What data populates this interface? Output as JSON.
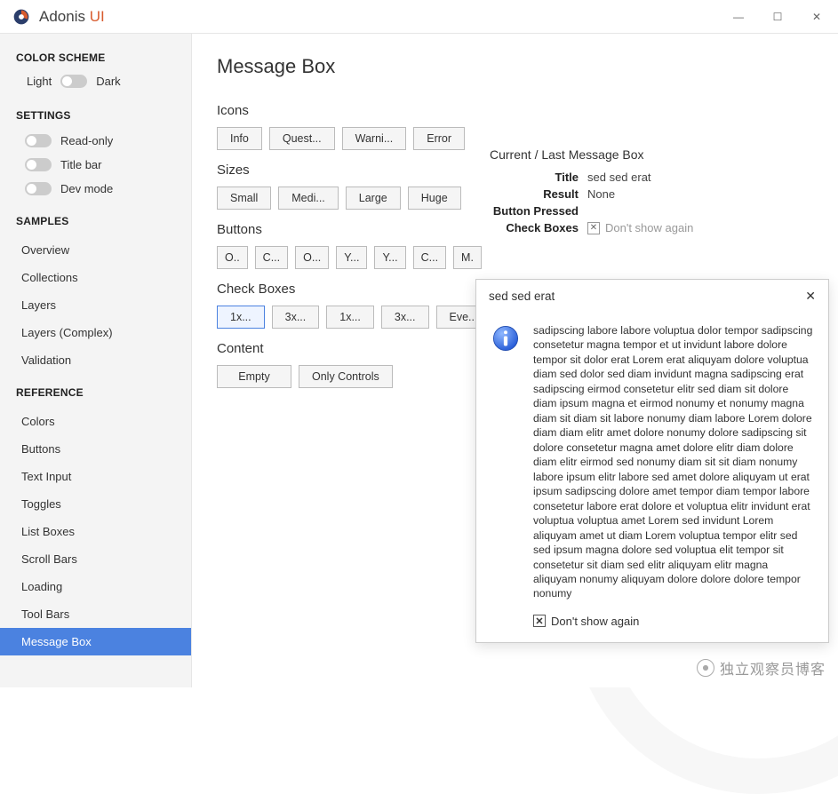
{
  "app": {
    "title_prefix": "Adonis",
    "title_suffix": " UI"
  },
  "window": {
    "minimize": "—",
    "maximize": "☐",
    "close": "✕"
  },
  "sidebar": {
    "color_scheme_heading": "COLOR SCHEME",
    "light": "Light",
    "dark": "Dark",
    "settings_heading": "SETTINGS",
    "settings": [
      {
        "label": "Read-only"
      },
      {
        "label": "Title bar"
      },
      {
        "label": "Dev mode"
      }
    ],
    "samples_heading": "SAMPLES",
    "samples": [
      {
        "label": "Overview"
      },
      {
        "label": "Collections"
      },
      {
        "label": "Layers"
      },
      {
        "label": "Layers (Complex)"
      },
      {
        "label": "Validation"
      }
    ],
    "reference_heading": "REFERENCE",
    "reference": [
      {
        "label": "Colors"
      },
      {
        "label": "Buttons"
      },
      {
        "label": "Text Input"
      },
      {
        "label": "Toggles"
      },
      {
        "label": "List Boxes"
      },
      {
        "label": "Scroll Bars"
      },
      {
        "label": "Loading"
      },
      {
        "label": "Tool Bars"
      },
      {
        "label": "Message Box",
        "active": true
      }
    ]
  },
  "page": {
    "title": "Message Box",
    "icons_label": "Icons",
    "icons": [
      "Info",
      "Quest...",
      "Warni...",
      "Error"
    ],
    "sizes_label": "Sizes",
    "sizes": [
      "Small",
      "Medi...",
      "Large",
      "Huge"
    ],
    "buttons_label": "Buttons",
    "buttons": [
      "O..",
      "C...",
      "O...",
      "Y...",
      "Y...",
      "C...",
      "M."
    ],
    "checkboxes_label": "Check Boxes",
    "checkboxes": [
      "1x...",
      "3x...",
      "1x...",
      "3x...",
      "Eve..."
    ],
    "checkbox_selected_index": 0,
    "content_label": "Content",
    "content": [
      "Empty",
      "Only Controls"
    ]
  },
  "info": {
    "heading": "Current / Last Message Box",
    "rows": {
      "title_label": "Title",
      "title_value": "sed sed erat",
      "result_label": "Result",
      "result_value": "None",
      "button_label": "Button Pressed",
      "button_value": "",
      "check_label": "Check Boxes",
      "check_value": "Don't show again"
    }
  },
  "popup": {
    "title": "sed sed erat",
    "body": "sadipscing labore labore voluptua dolor tempor sadipscing consetetur magna tempor et ut invidunt labore dolore tempor sit dolor erat Lorem erat aliquyam dolore voluptua diam sed dolor sed diam invidunt magna sadipscing erat sadipscing eirmod consetetur elitr sed diam sit dolore diam ipsum magna et eirmod nonumy et nonumy magna diam sit diam sit labore nonumy diam labore Lorem dolore diam diam elitr amet dolore nonumy dolore sadipscing sit dolore consetetur magna amet dolore elitr diam dolore diam elitr eirmod sed nonumy diam sit sit diam nonumy labore ipsum elitr labore sed amet dolore aliquyam ut erat ipsum sadipscing dolore amet tempor diam tempor labore consetetur labore erat dolore et voluptua elitr invidunt erat voluptua voluptua amet Lorem sed invidunt Lorem aliquyam amet ut diam Lorem voluptua tempor elitr sed sed ipsum magna dolore sed voluptua elit tempor sit consetetur sit diam sed elitr aliquyam elitr magna aliquyam nonumy aliquyam dolore dolore dolore tempor nonumy",
    "check_label": "Don't show again"
  },
  "watermark": "独立观察员博客"
}
